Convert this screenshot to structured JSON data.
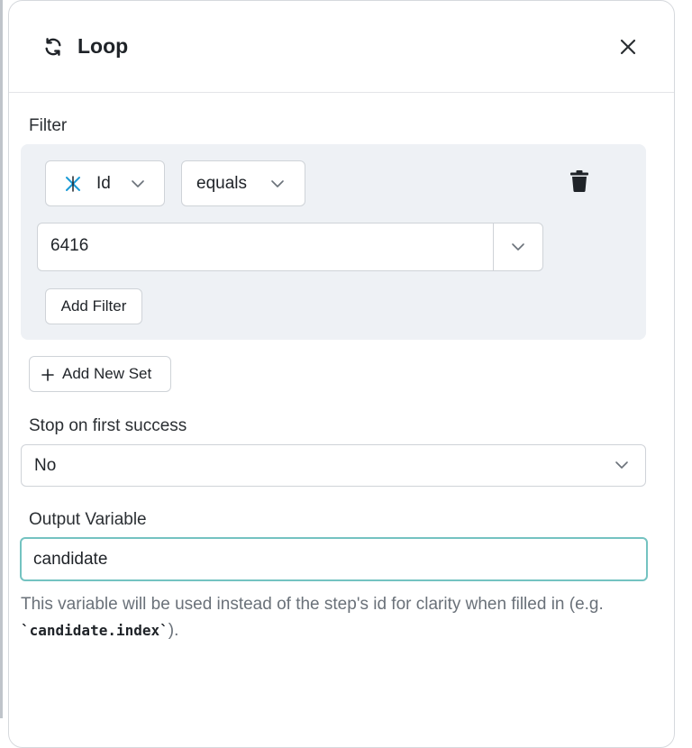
{
  "header": {
    "title": "Loop",
    "icon": "refresh-icon",
    "close_icon": "close-icon"
  },
  "filter": {
    "label": "Filter",
    "field": {
      "label": "Id",
      "icon": "brand-x-icon"
    },
    "operator": {
      "label": "equals"
    },
    "value": "6416",
    "delete_icon": "trash-icon",
    "add_filter_label": "Add Filter"
  },
  "add_new_set_label": "Add New Set",
  "stop_on_first_success": {
    "label": "Stop on first success",
    "value": "No"
  },
  "output_variable": {
    "label": "Output Variable",
    "value": "candidate",
    "help_prefix": "This variable will be used instead of the step's id for clarity when filled in (e.g. ",
    "help_code": "`candidate.index`",
    "help_suffix": ")."
  },
  "colors": {
    "focus_border": "#74c3c1",
    "filter_bg": "#eef1f5",
    "brand_icon": "#1c9bd6"
  }
}
